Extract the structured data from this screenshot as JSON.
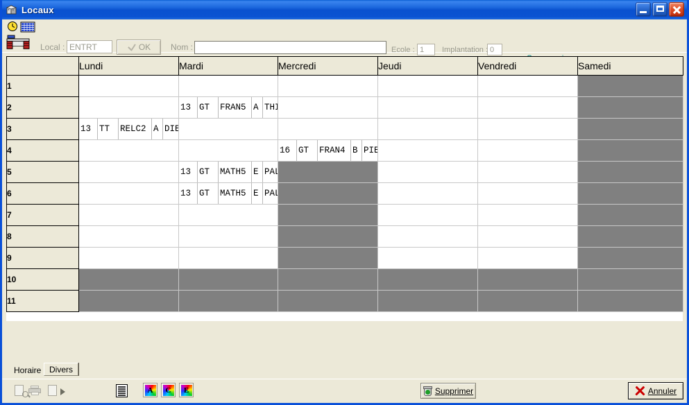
{
  "window": {
    "title": "Locaux",
    "icon": "building-icon",
    "controls": {
      "minimize": "minimize-button",
      "maximize": "maximize-button",
      "close": "close-button"
    }
  },
  "form": {
    "local_label": "Local :",
    "local_value": "ENTRT",
    "ok_label": "OK",
    "nom_label": "Nom :",
    "nom_value": "",
    "nom_placeholder": "",
    "ecole_label": "Ecole :",
    "ecole_value": "1",
    "implantation_label": "Implantation :",
    "implantation_value": "0",
    "suppression_text": "Suppression",
    "suppression_color": "#008080"
  },
  "timetable": {
    "corner_header": "",
    "day_headers": [
      "Lundi",
      "Mardi",
      "Mercredi",
      "Jeudi",
      "Vendredi",
      "Samedi"
    ],
    "period_labels": [
      "1",
      "2",
      "3",
      "4",
      "5",
      "6",
      "7",
      "8",
      "9",
      "10",
      "11"
    ],
    "disabled_color": "#808080",
    "rows": [
      {
        "period": "1",
        "cells": [
          {
            "state": "empty"
          },
          {
            "state": "empty"
          },
          {
            "state": "empty"
          },
          {
            "state": "empty"
          },
          {
            "state": "empty"
          },
          {
            "state": "disabled"
          }
        ]
      },
      {
        "period": "2",
        "cells": [
          {
            "state": "empty"
          },
          {
            "state": "filled",
            "num": "13",
            "type": "GT",
            "code": "FRAN5",
            "group": "A",
            "teacher": "THICH"
          },
          {
            "state": "empty"
          },
          {
            "state": "empty"
          },
          {
            "state": "empty"
          },
          {
            "state": "disabled"
          }
        ]
      },
      {
        "period": "3",
        "cells": [
          {
            "state": "filled",
            "num": "13",
            "type": "TT",
            "code": "RELC2",
            "group": "A",
            "teacher": "DIEDE"
          },
          {
            "state": "empty"
          },
          {
            "state": "empty"
          },
          {
            "state": "empty"
          },
          {
            "state": "empty"
          },
          {
            "state": "disabled"
          }
        ]
      },
      {
        "period": "4",
        "cells": [
          {
            "state": "empty"
          },
          {
            "state": "empty"
          },
          {
            "state": "filled",
            "num": "16",
            "type": "GT",
            "code": "FRAN4",
            "group": "B",
            "teacher": "PIEJM"
          },
          {
            "state": "empty"
          },
          {
            "state": "empty"
          },
          {
            "state": "disabled"
          }
        ]
      },
      {
        "period": "5",
        "cells": [
          {
            "state": "empty"
          },
          {
            "state": "filled",
            "num": "13",
            "type": "GT",
            "code": "MATH5",
            "group": "E",
            "teacher": "PALMI"
          },
          {
            "state": "disabled"
          },
          {
            "state": "empty"
          },
          {
            "state": "empty"
          },
          {
            "state": "disabled"
          }
        ]
      },
      {
        "period": "6",
        "cells": [
          {
            "state": "empty"
          },
          {
            "state": "filled",
            "num": "13",
            "type": "GT",
            "code": "MATH5",
            "group": "E",
            "teacher": "PALMI"
          },
          {
            "state": "disabled"
          },
          {
            "state": "empty"
          },
          {
            "state": "empty"
          },
          {
            "state": "disabled"
          }
        ]
      },
      {
        "period": "7",
        "cells": [
          {
            "state": "empty"
          },
          {
            "state": "empty"
          },
          {
            "state": "disabled"
          },
          {
            "state": "empty"
          },
          {
            "state": "empty"
          },
          {
            "state": "disabled"
          }
        ]
      },
      {
        "period": "8",
        "cells": [
          {
            "state": "empty"
          },
          {
            "state": "empty"
          },
          {
            "state": "disabled"
          },
          {
            "state": "empty"
          },
          {
            "state": "empty"
          },
          {
            "state": "disabled"
          }
        ]
      },
      {
        "period": "9",
        "cells": [
          {
            "state": "empty"
          },
          {
            "state": "empty"
          },
          {
            "state": "disabled"
          },
          {
            "state": "empty"
          },
          {
            "state": "empty"
          },
          {
            "state": "disabled"
          }
        ]
      },
      {
        "period": "10",
        "cells": [
          {
            "state": "disabled"
          },
          {
            "state": "disabled"
          },
          {
            "state": "disabled"
          },
          {
            "state": "disabled"
          },
          {
            "state": "disabled"
          },
          {
            "state": "disabled"
          }
        ]
      },
      {
        "period": "11",
        "cells": [
          {
            "state": "disabled"
          },
          {
            "state": "disabled"
          },
          {
            "state": "disabled"
          },
          {
            "state": "disabled"
          },
          {
            "state": "disabled"
          },
          {
            "state": "disabled"
          }
        ]
      }
    ]
  },
  "tabs": [
    {
      "label": "Horaire",
      "active": false
    },
    {
      "label": "Divers",
      "active": true
    }
  ],
  "bottom_toolbar": {
    "icons": [
      {
        "name": "print-preview-icon",
        "enabled": false
      },
      {
        "name": "print-icon",
        "enabled": false
      },
      {
        "name": "export-icon",
        "enabled": false
      },
      {
        "name": "list-icon",
        "enabled": true
      }
    ],
    "ace_buttons": [
      {
        "letter": "A",
        "name": "format-a-button"
      },
      {
        "letter": "C",
        "name": "format-c-button"
      },
      {
        "letter": "E",
        "name": "format-e-button"
      }
    ],
    "supprimer_label": "Supprimer",
    "annuler_label": "Annuler"
  }
}
